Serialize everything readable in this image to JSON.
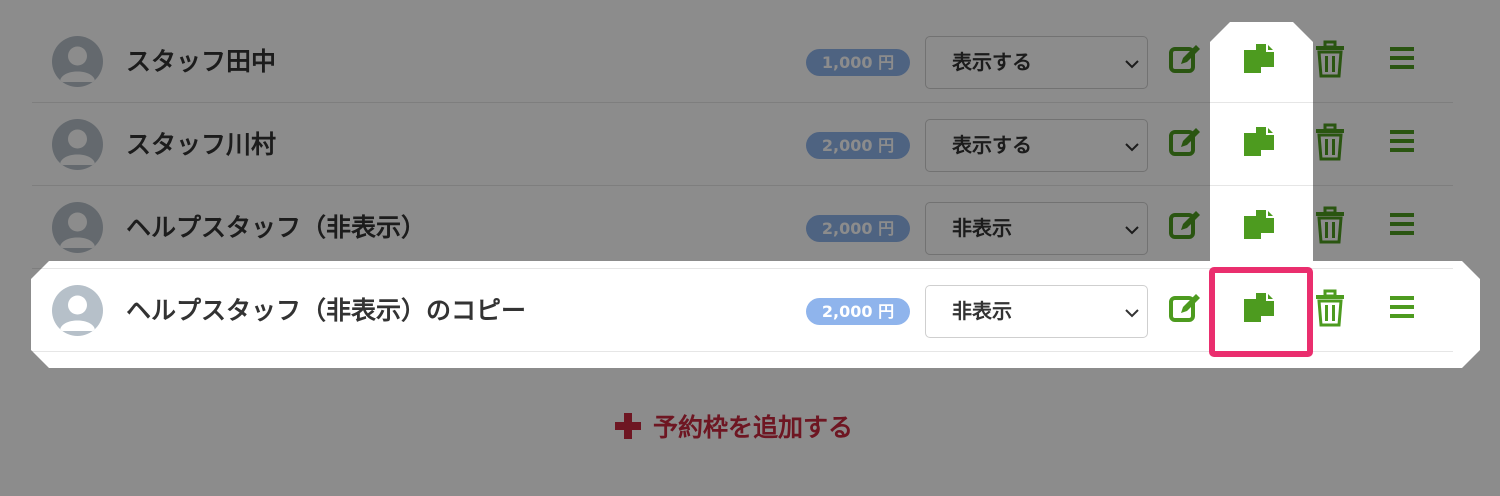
{
  "staff_list": [
    {
      "name": "スタッフ田中",
      "price": "1,000 円",
      "visibility": "表示する"
    },
    {
      "name": "スタッフ川村",
      "price": "2,000 円",
      "visibility": "表示する"
    },
    {
      "name": "ヘルプスタッフ（非表示）",
      "price": "2,000 円",
      "visibility": "非表示"
    },
    {
      "name": "ヘルプスタッフ（非表示）のコピー",
      "price": "2,000 円",
      "visibility": "非表示"
    }
  ],
  "add_slot_label": "予約枠を追加する",
  "icons": {
    "avatar": "user-avatar-icon",
    "edit": "edit-icon",
    "copy": "copy-icon",
    "delete": "trash-icon",
    "reorder": "menu-icon",
    "dropdown": "chevron-down-icon",
    "add": "plus-icon"
  },
  "colors": {
    "icon_green": "#4d9b1f",
    "price_badge": "#8fb4ec",
    "add_link": "#c8283f",
    "highlight": "#ea2e6e"
  }
}
